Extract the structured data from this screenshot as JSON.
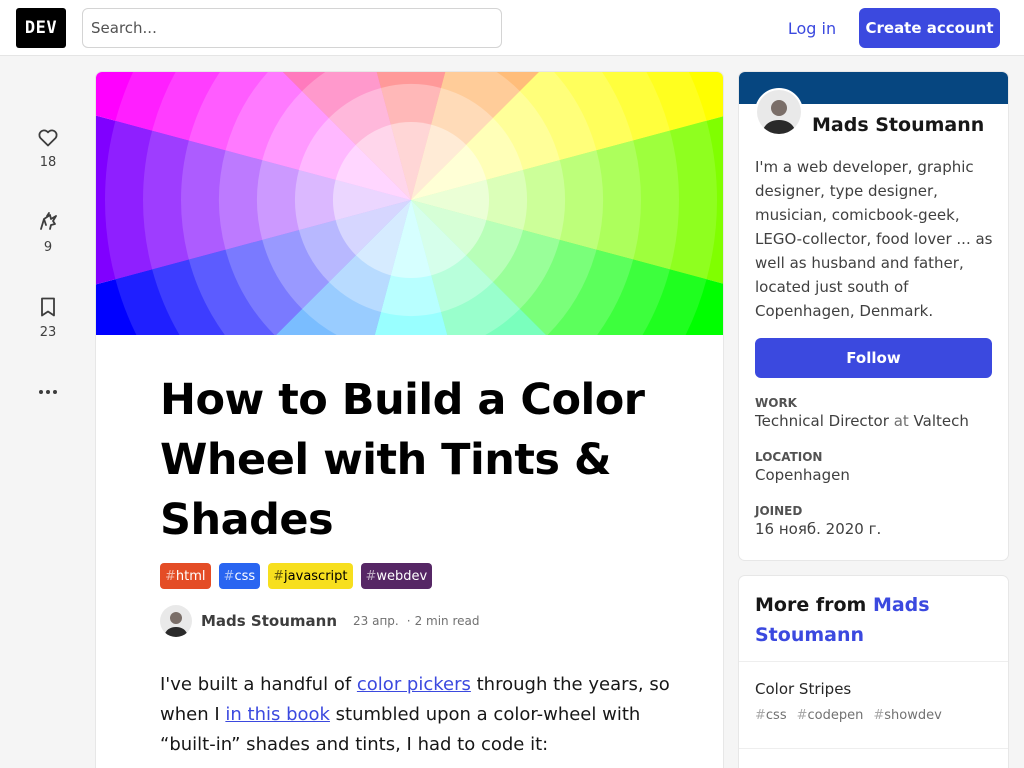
{
  "header": {
    "logo": "DEV",
    "search_placeholder": "Search...",
    "login_label": "Log in",
    "create_account_label": "Create account"
  },
  "reactions": [
    {
      "icon": "heart-icon",
      "count": "18"
    },
    {
      "icon": "unicorn-icon",
      "count": "9"
    },
    {
      "icon": "bookmark-icon",
      "count": "23"
    }
  ],
  "article": {
    "title": "How to Build a Color Wheel with Tints & Shades",
    "tags": [
      {
        "name": "html",
        "bg": "#e44d26",
        "fg": "#ffffff"
      },
      {
        "name": "css",
        "bg": "#2965f1",
        "fg": "#ffffff"
      },
      {
        "name": "javascript",
        "bg": "#f7df1e",
        "fg": "#000000"
      },
      {
        "name": "webdev",
        "bg": "#562765",
        "fg": "#ffffff"
      }
    ],
    "author": "Mads Stoumann",
    "date": "23 апр.",
    "read_time": "2 min read",
    "body": {
      "p1_a": "I've built a handful of ",
      "p1_link1": "color pickers",
      "p1_b": " through the years, so when I ",
      "p1_link2": "in this book",
      "p1_c": " stumbled upon a color-wheel with “built-in” shades and tints, I had to code it:"
    }
  },
  "profile": {
    "name": "Mads Stoumann",
    "bio": "I'm a web developer, graphic designer, type designer, musician, comicbook-geek, LEGO-collector, food lover ... as well as husband and father, located just south of Copenhagen, Denmark.",
    "follow_label": "Follow",
    "work_label": "Work",
    "work_role": "Technical Director",
    "work_at": "at",
    "work_company": "Valtech",
    "location_label": "Location",
    "location_value": "Copenhagen",
    "joined_label": "Joined",
    "joined_value": "16 нояб. 2020 г."
  },
  "more_from": {
    "prefix": "More from",
    "author": "Mads Stoumann",
    "items": [
      {
        "title": "Color Stripes",
        "tags": [
          "css",
          "codepen",
          "showdev"
        ]
      }
    ]
  },
  "colors": {
    "accent": "#3b49df",
    "brand_bar": "#064680"
  }
}
